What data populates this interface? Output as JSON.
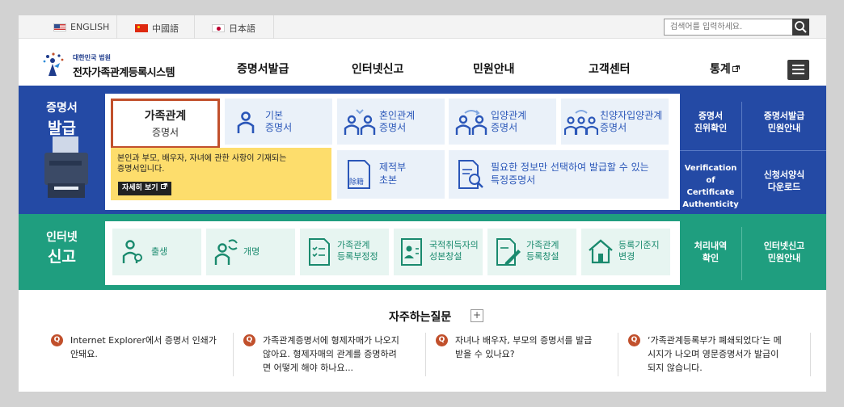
{
  "topbar": {
    "languages": [
      "ENGLISH",
      "中國語",
      "日本語"
    ],
    "search_placeholder": "검색어를 입력하세요.",
    "colors": {
      "bg": "#f3f3f3",
      "search_btn": "#3a3a3a"
    }
  },
  "header": {
    "logo_small": "대한민국 법원",
    "logo_main": "전자가족관계등록시스템",
    "nav": [
      "증명서발급",
      "인터넷신고",
      "민원안내",
      "고객센터",
      "통계"
    ]
  },
  "band1": {
    "label_line1": "증명서",
    "label_line2": "발급",
    "color": "#244aa5",
    "highlight": {
      "title": "가족관계",
      "sub": "증명서"
    },
    "tiles": [
      {
        "l1": "기본",
        "l2": "증명서",
        "icon": "person-icon"
      },
      {
        "l1": "혼인관계",
        "l2": "증명서",
        "icon": "couple-icon"
      },
      {
        "l1": "입양관계",
        "l2": "증명서",
        "icon": "adoption-icon"
      },
      {
        "l1": "친양자입양관계",
        "l2": "증명서",
        "icon": "family-icon"
      },
      {
        "l1": "제적부",
        "l2": "초본",
        "icon": "register-icon"
      },
      {
        "l1": "필요한 정보만 선택하여 발급할 수 있는",
        "l2": "특정증명서",
        "icon": "doc-search-icon"
      }
    ],
    "tooltip": {
      "line1": "본인과 부모, 배우자, 자녀에 관한 사항이 기재되는",
      "line2": "증명서입니다.",
      "button": "자세히 보기"
    },
    "side": [
      {
        "l1": "증명서",
        "l2": "진위확인"
      },
      {
        "l1": "증명서발급",
        "l2": "민원안내"
      },
      {
        "l1": "Verification of",
        "l2": "Certificate",
        "l3": "Authenticity"
      },
      {
        "l1": "신청서양식",
        "l2": "다운로드"
      }
    ]
  },
  "band2": {
    "label_line1": "인터넷",
    "label_line2": "신고",
    "color": "#1f9e7f",
    "tiles": [
      {
        "l1": "출생",
        "icon": "baby-icon"
      },
      {
        "l1": "개명",
        "icon": "rename-icon"
      },
      {
        "l1": "가족관계",
        "l2": "등록부정정",
        "icon": "checklist-icon"
      },
      {
        "l1": "국적취득자의",
        "l2": "성본창설",
        "icon": "id-card-icon"
      },
      {
        "l1": "가족관계",
        "l2": "등록창설",
        "icon": "pen-doc-icon"
      },
      {
        "l1": "등록기준지",
        "l2": "변경",
        "icon": "house-icon"
      }
    ],
    "side": [
      {
        "l1": "처리내역",
        "l2": "확인"
      },
      {
        "l1": "인터넷신고",
        "l2": "민원안내"
      }
    ]
  },
  "faq": {
    "title": "자주하는질문",
    "plus": "+",
    "q_mark": "Q",
    "items": [
      {
        "l1": "Internet Explorer에서 증명서 인쇄가",
        "l2": "안돼요.",
        "l3": ""
      },
      {
        "l1": "가족관계증명서에 형제자매가 나오지",
        "l2": "않아요. 형제자매의 관계를 증명하려",
        "l3": "면 어떻게 해야 하나요..."
      },
      {
        "l1": "자녀나 배우자, 부모의 증명서를 발급",
        "l2": "받을 수 있나요?",
        "l3": ""
      },
      {
        "l1": "‘가족관계등록부가 폐쇄되었다’는 메",
        "l2": "시지가 나오며 영문증명서가 발급이",
        "l3": "되지 않습니다."
      }
    ]
  }
}
